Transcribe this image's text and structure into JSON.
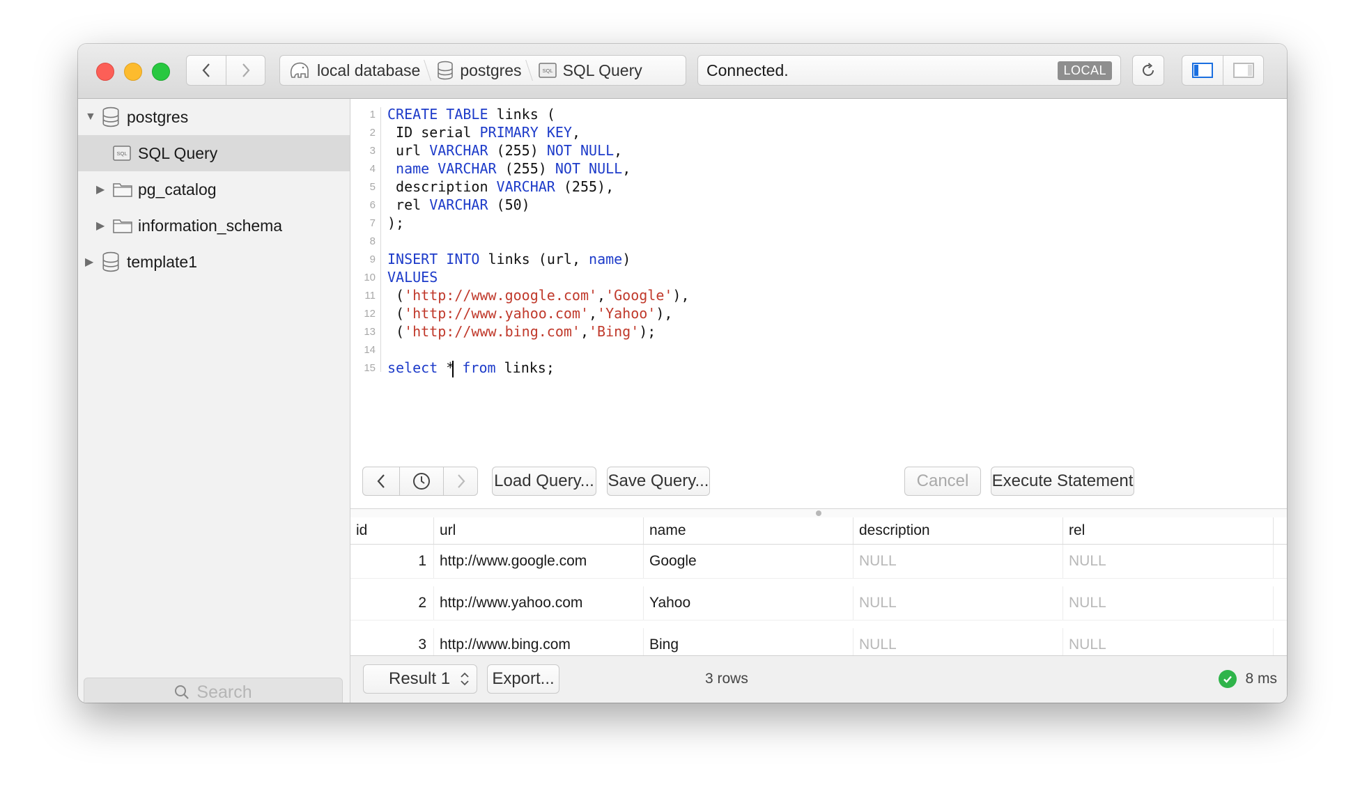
{
  "window": {
    "breadcrumbs": [
      {
        "label": "local database",
        "icon": "elephant-icon"
      },
      {
        "label": "postgres",
        "icon": "database-icon"
      },
      {
        "label": "SQL Query",
        "icon": "sql-file-icon"
      }
    ],
    "status_text": "Connected.",
    "status_badge": "LOCAL"
  },
  "sidebar": {
    "items": [
      {
        "label": "postgres",
        "icon": "database-icon",
        "expanded": true
      },
      {
        "label": "SQL Query",
        "icon": "sql-file-icon",
        "selected": true
      },
      {
        "label": "pg_catalog",
        "icon": "folder-icon",
        "expanded": false
      },
      {
        "label": "information_schema",
        "icon": "folder-icon",
        "expanded": false
      },
      {
        "label": "template1",
        "icon": "database-icon",
        "expanded": false
      }
    ],
    "search_placeholder": "Search"
  },
  "editor": {
    "lines": [
      "CREATE TABLE links (",
      " ID serial PRIMARY KEY,",
      " url VARCHAR (255) NOT NULL,",
      " name VARCHAR (255) NOT NULL,",
      " description VARCHAR (255),",
      " rel VARCHAR (50)",
      ");",
      "",
      "INSERT INTO links (url, name)",
      "VALUES",
      " ('http://www.google.com','Google'),",
      " ('http://www.yahoo.com','Yahoo'),",
      " ('http://www.bing.com','Bing');",
      "",
      "select * from links;"
    ],
    "line_numbers": [
      "1",
      "2",
      "3",
      "4",
      "5",
      "6",
      "7",
      "8",
      "9",
      "10",
      "11",
      "12",
      "13",
      "14",
      "15"
    ]
  },
  "toolbar": {
    "load_label": "Load Query...",
    "save_label": "Save Query...",
    "cancel_label": "Cancel",
    "execute_label": "Execute Statement"
  },
  "results": {
    "columns": [
      "id",
      "url",
      "name",
      "description",
      "rel"
    ],
    "rows": [
      [
        "1",
        "http://www.google.com",
        "Google",
        "NULL",
        "NULL"
      ],
      [
        "2",
        "http://www.yahoo.com",
        "Yahoo",
        "NULL",
        "NULL"
      ],
      [
        "3",
        "http://www.bing.com",
        "Bing",
        "NULL",
        "NULL"
      ]
    ]
  },
  "footer": {
    "result_selector": "Result 1",
    "export_label": "Export...",
    "row_count": "3 rows",
    "timing": "8 ms"
  },
  "colors": {
    "keyword": "#1d3bc9",
    "string": "#c0392b",
    "success": "#2fb44a"
  }
}
